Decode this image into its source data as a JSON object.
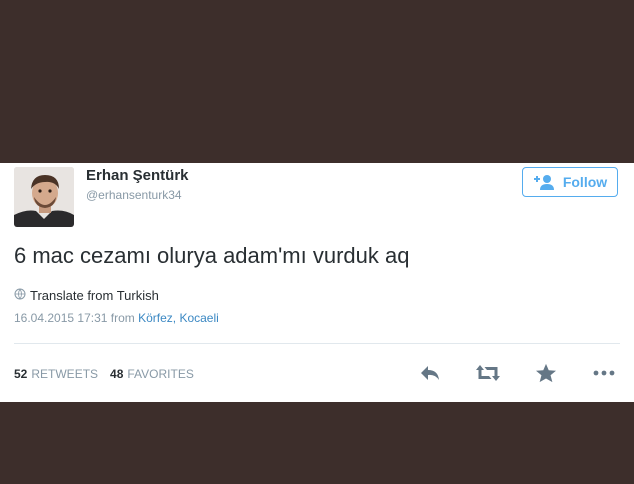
{
  "tweet": {
    "display_name": "Erhan Şentürk",
    "handle": "@erhansenturk34",
    "follow_label": "Follow",
    "text": "6 mac cezamı olurya adam'mı vurduk aq",
    "translate_label": "Translate from Turkish",
    "timestamp": "16.04.2015 17:31",
    "from_word": "from",
    "location": "Körfez, Kocaeli",
    "retweets_count": "52",
    "retweets_label": "RETWEETS",
    "favorites_count": "48",
    "favorites_label": "FAVORITES"
  },
  "colors": {
    "accent": "#55acee",
    "text": "#292f33",
    "muted": "#8899a6",
    "icons": "#657786",
    "background": "#3d2e2b"
  },
  "icons": [
    "follow-person-icon",
    "globe-icon",
    "reply-icon",
    "retweet-icon",
    "favorite-star-icon",
    "more-icon"
  ]
}
